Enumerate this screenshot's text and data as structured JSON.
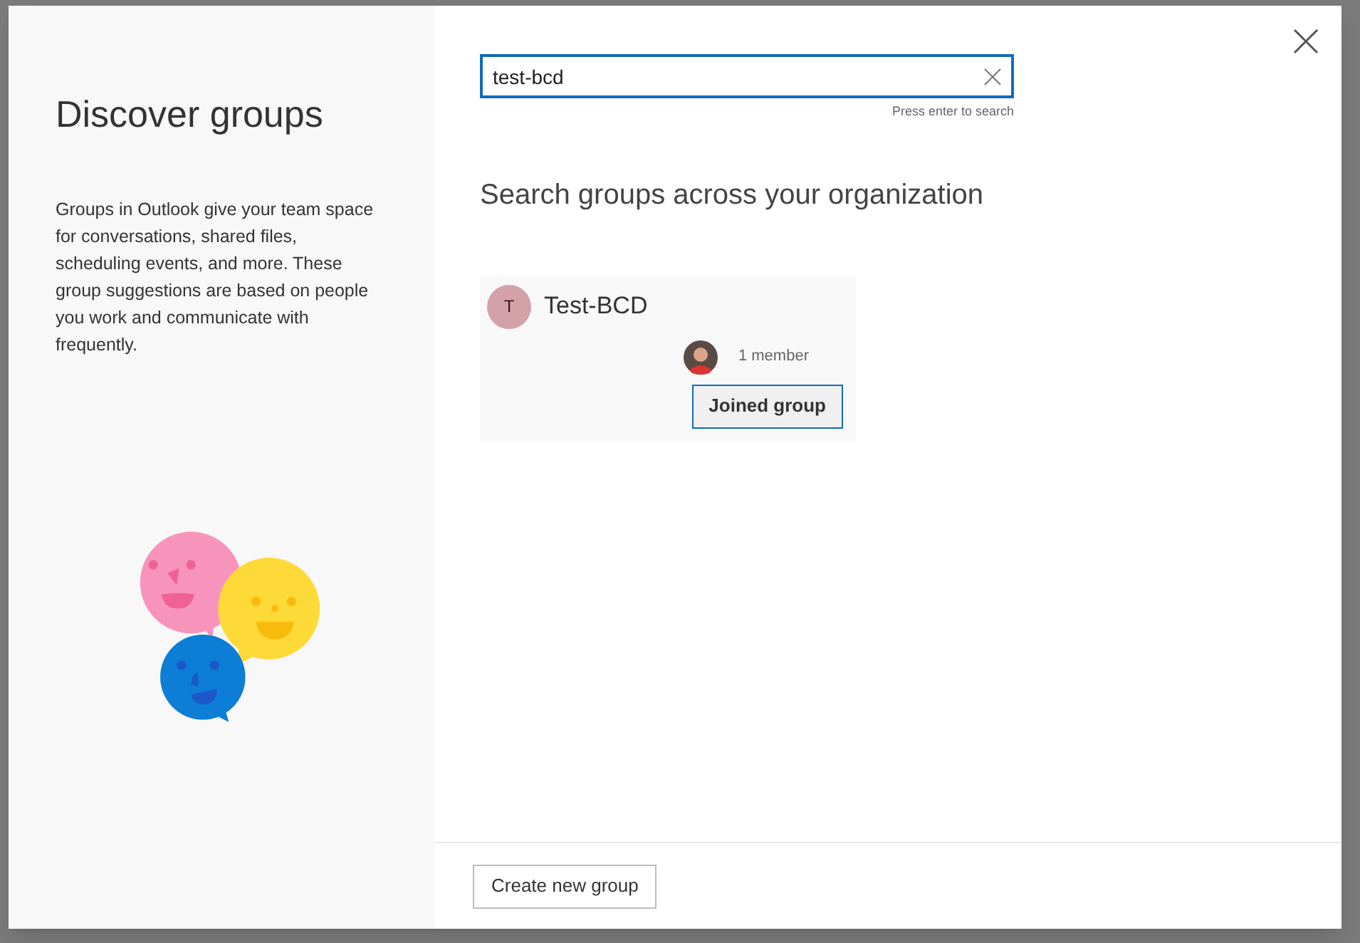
{
  "dialog": {
    "title": "Discover groups",
    "description": "Groups in Outlook give your team space for conversations, shared files, scheduling events, and more. These group suggestions are based on people you work and communicate with frequently."
  },
  "search": {
    "value": "test-bcd",
    "hint": "Press enter to search"
  },
  "heading": "Search groups across your organization",
  "groups": [
    {
      "initial": "T",
      "name": "Test-BCD",
      "color": "#d4a1a9",
      "members": "1 member",
      "action": "Joined group"
    }
  ],
  "footer": {
    "button": "Create new group"
  }
}
